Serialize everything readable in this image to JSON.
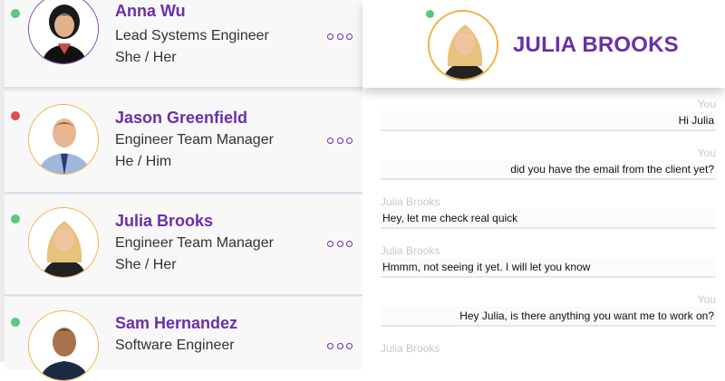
{
  "contacts": [
    {
      "name": "Anna Wu",
      "role": "Lead Systems Engineer",
      "pronouns": "She / Her",
      "status_color": "#5ac87e",
      "ring_color": "#7a3fb5"
    },
    {
      "name": "Jason Greenfield",
      "role": "Engineer Team Manager",
      "pronouns": "He / Him",
      "status_color": "#e24b4b",
      "ring_color": "#f1b043"
    },
    {
      "name": "Julia Brooks",
      "role": "Engineer Team Manager",
      "pronouns": "She / Her",
      "status_color": "#5ac87e",
      "ring_color": "#f1b043"
    },
    {
      "name": "Sam Hernandez",
      "role": "Software Engineer",
      "pronouns": "",
      "status_color": "#5ac87e",
      "ring_color": "#f1b043"
    }
  ],
  "chat": {
    "header_name": "JULIA BROOKS",
    "status_color": "#5ac87e",
    "messages": [
      {
        "sender": "You",
        "text": "Hi Julia",
        "side": "you"
      },
      {
        "sender": "You",
        "text": "did you have the email from the client yet?",
        "side": "you"
      },
      {
        "sender": "Julia Brooks",
        "text": "Hey, let me check real quick",
        "side": "them"
      },
      {
        "sender": "Julia Brooks",
        "text": "Hmmm, not seeing it yet. I will let you know",
        "side": "them"
      },
      {
        "sender": "You",
        "text": "Hey Julia, is there anything you want me to work on?",
        "side": "you"
      },
      {
        "sender": "Julia Brooks",
        "text": "",
        "side": "them"
      }
    ]
  },
  "icons": {
    "more": "more-horizontal-icon",
    "status": "status-dot-icon"
  },
  "colors": {
    "accent": "#6b2fa8",
    "online": "#5ac87e",
    "busy": "#e24b4b",
    "ring": "#f1b043"
  }
}
